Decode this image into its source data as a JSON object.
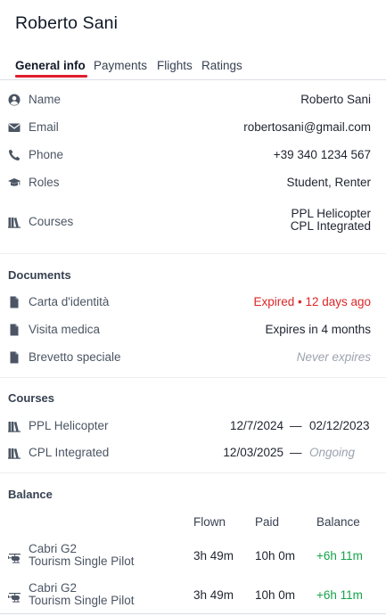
{
  "header": {
    "title": "Roberto Sani"
  },
  "tabs": [
    {
      "label": "General info",
      "active": true
    },
    {
      "label": "Payments",
      "active": false
    },
    {
      "label": "Flights",
      "active": false
    },
    {
      "label": "Ratings",
      "active": false
    }
  ],
  "colors": {
    "accent": "#e11d2e",
    "expired": "#dc2626",
    "positive": "#16a34a",
    "muted": "#9ca3af"
  },
  "general": {
    "name": {
      "icon": "user-circle-icon",
      "label": "Name",
      "value": "Roberto Sani"
    },
    "email": {
      "icon": "envelope-icon",
      "label": "Email",
      "value": "robertosani@gmail.com"
    },
    "phone": {
      "icon": "phone-icon",
      "label": "Phone",
      "value": "+39 340 1234 567"
    },
    "roles": {
      "icon": "graduation-cap-icon",
      "label": "Roles",
      "value": "Student, Renter"
    },
    "courses": {
      "icon": "books-icon",
      "label": "Courses",
      "values": [
        "PPL Helicopter",
        "CPL Integrated"
      ]
    }
  },
  "documents": {
    "title": "Documents",
    "items": [
      {
        "icon": "document-icon",
        "label": "Carta d'identità",
        "status": "Expired • 12 days ago"
      },
      {
        "icon": "document-icon",
        "label": "Visita medica",
        "status": "Expires in 4 months"
      },
      {
        "icon": "document-icon",
        "label": "Brevetto speciale",
        "status": "Never expires"
      }
    ]
  },
  "courses": {
    "title": "Courses",
    "items": [
      {
        "icon": "books-icon",
        "name": "PPL Helicopter",
        "start": "12/7/2024",
        "separator": "—",
        "end": "02/12/2023"
      },
      {
        "icon": "books-icon",
        "name": "CPL Integrated",
        "start": "12/03/2025",
        "separator": "—",
        "end": "Ongoing"
      }
    ]
  },
  "balance": {
    "title": "Balance",
    "headers": {
      "flown": "Flown",
      "paid": "Paid",
      "balance": "Balance"
    },
    "rows": [
      {
        "icon": "helicopter-icon",
        "aircraft": "Cabri G2",
        "course": "Tourism Single Pilot",
        "flown": "3h 49m",
        "paid": "10h 0m",
        "balance": "+6h 11m"
      },
      {
        "icon": "helicopter-icon",
        "aircraft": "Cabri G2",
        "course": "Tourism Single Pilot",
        "flown": "3h 49m",
        "paid": "10h 0m",
        "balance": "+6h 11m"
      }
    ]
  }
}
